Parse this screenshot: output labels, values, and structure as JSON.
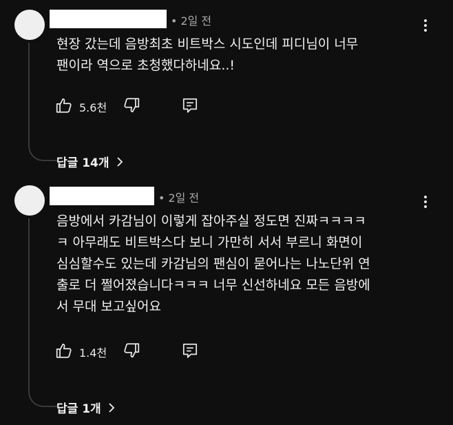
{
  "comments": [
    {
      "time": "2일 전",
      "body_lines": [
        "현장 갔는데 음방최초 비트박스 시도인데 피디님이 너무",
        "팬이라 역으로 초청했다하네요..!"
      ],
      "likes": "5.6천",
      "replies_label": "답글 14개"
    },
    {
      "time": "2일 전",
      "body_lines": [
        "음방에서 카감님이 이렇게 잡아주실 정도면 진짜ㅋㅋㅋㅋ",
        "ㅋ 아무래도 비트박스다 보니 가만히 서서 부르니 화면이",
        "심심할수도 있는데 카감님의 팬심이 묻어나는 나노단위 연",
        "출로 더 쩔어졌습니다ㅋㅋㅋ 너무 신선하네요 모든 음방에",
        "서 무대 보고싶어요"
      ],
      "likes": "1.4천",
      "replies_label": "답글 1개"
    }
  ],
  "icons": {
    "like": "thumbs-up-icon",
    "dislike": "thumbs-down-icon",
    "reply": "reply-comment-icon",
    "more": "more-vertical-icon",
    "chevron": "chevron-right-icon"
  },
  "colors": {
    "background": "#0f0f0f",
    "text": "#f1f1f1",
    "meta": "#aaaaaa",
    "avatar": "#efefef",
    "thread_line": "#3a3a3a"
  }
}
